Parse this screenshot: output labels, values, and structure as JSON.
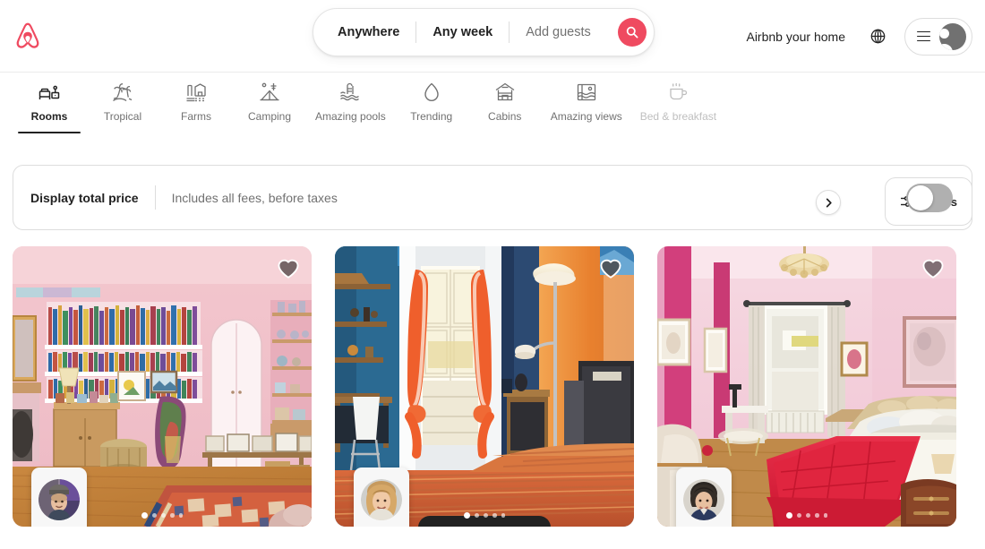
{
  "header": {
    "logo_icon": "airbnb-belo-logo",
    "logo_color": "#ef4a60",
    "search": {
      "location": "Anywhere",
      "dates": "Any week",
      "guests_placeholder": "Add guests",
      "search_icon": "search-icon",
      "search_button_color": "#ef4a60"
    },
    "host_link": "Airbnb your home",
    "globe_icon": "globe-icon",
    "menu_icon": "hamburger-menu-icon",
    "avatar_icon": "user-avatar-icon"
  },
  "categories": {
    "items": [
      {
        "label": "Rooms",
        "icon": "bed-room-icon",
        "active": true
      },
      {
        "label": "Tropical",
        "icon": "palm-tree-icon",
        "active": false
      },
      {
        "label": "Farms",
        "icon": "barn-farm-icon",
        "active": false
      },
      {
        "label": "Camping",
        "icon": "tent-camping-icon",
        "active": false
      },
      {
        "label": "Amazing pools",
        "icon": "pool-waves-icon",
        "active": false
      },
      {
        "label": "Trending",
        "icon": "flame-trending-icon",
        "active": false
      },
      {
        "label": "Cabins",
        "icon": "log-cabin-icon",
        "active": false
      },
      {
        "label": "Amazing views",
        "icon": "scenic-view-icon",
        "active": false
      },
      {
        "label": "Bed & breakfast",
        "icon": "coffee-cup-icon",
        "active": false
      }
    ],
    "next_arrow_icon": "chevron-right-icon",
    "filters_label": "Filters",
    "filters_icon": "filter-sliders-icon"
  },
  "price_bar": {
    "title": "Display total price",
    "subtitle": "Includes all fees, before taxes",
    "toggle_state": "off",
    "toggle_icon": "toggle-switch-icon"
  },
  "listings": [
    {
      "photo_description": "pink-room-with-bookshelves",
      "favorite_icon": "heart-icon",
      "favorited": false,
      "host_badge_icon": "host-avatar-badge",
      "carousel_dots": 5,
      "carousel_active_index": 0
    },
    {
      "photo_description": "blue-orange-room-with-balcony-window",
      "favorite_icon": "heart-icon",
      "favorited": false,
      "host_badge_icon": "host-avatar-badge",
      "carousel_dots": 5,
      "carousel_active_index": 0
    },
    {
      "photo_description": "pink-bedroom-with-red-bedspread",
      "favorite_icon": "heart-icon",
      "favorited": false,
      "host_badge_icon": "host-avatar-badge",
      "carousel_dots": 5,
      "carousel_active_index": 0
    }
  ]
}
